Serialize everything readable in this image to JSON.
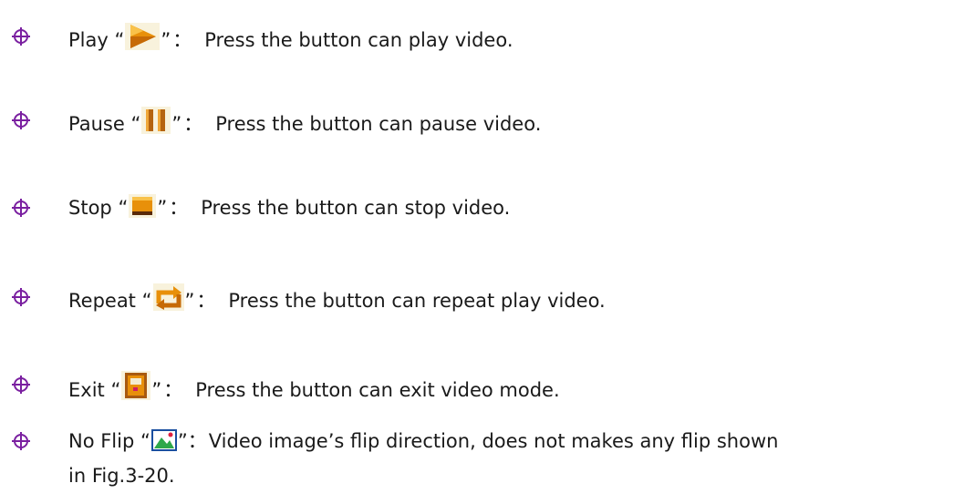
{
  "items": [
    {
      "name": "Play",
      "open_quote": "“",
      "close_quote": "”",
      "colon": "：",
      "icon": "play-icon",
      "description": "Press the button can play video."
    },
    {
      "name": "Pause",
      "open_quote": "“",
      "close_quote": "”",
      "colon": "：",
      "icon": "pause-icon",
      "description": "Press the button can pause video."
    },
    {
      "name": "Stop",
      "open_quote": "“",
      "close_quote": "”",
      "colon": "：",
      "icon": "stop-icon",
      "description": "Press the button can stop video."
    },
    {
      "name": "Repeat",
      "open_quote": "“",
      "close_quote": "”",
      "colon": "：",
      "icon": "repeat-icon",
      "description": "Press the button can repeat play video."
    },
    {
      "name": "Exit",
      "open_quote": "“",
      "close_quote": "”",
      "colon": "：",
      "icon": "exit-icon",
      "description": "Press the button can exit video mode."
    },
    {
      "name": "No Flip",
      "open_quote": "“",
      "close_quote": "”",
      "colon": "：",
      "icon": "no-flip-icon",
      "description": "Video image’s flip direction, does not makes any flip shown",
      "description_line2": "in Fig.3-20."
    }
  ],
  "colors": {
    "bullet": "#7a1fa0",
    "text": "#1a1a1a",
    "icon_orange": "#e8900a",
    "icon_brown": "#a85a10",
    "icon_bg": "#f4ecd0"
  }
}
